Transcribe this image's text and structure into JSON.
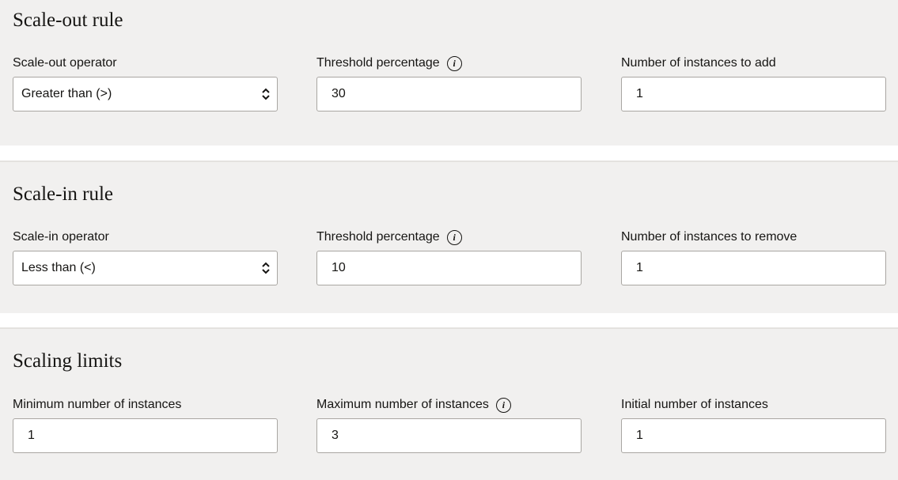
{
  "scale_out": {
    "title": "Scale-out rule",
    "operator_label": "Scale-out operator",
    "operator_value": "Greater than (>)",
    "threshold_label": "Threshold percentage",
    "threshold_value": "30",
    "count_label": "Number of instances to add",
    "count_value": "1"
  },
  "scale_in": {
    "title": "Scale-in rule",
    "operator_label": "Scale-in operator",
    "operator_value": "Less than (<)",
    "threshold_label": "Threshold percentage",
    "threshold_value": "10",
    "count_label": "Number of instances to remove",
    "count_value": "1"
  },
  "limits": {
    "title": "Scaling limits",
    "min_label": "Minimum number of instances",
    "min_value": "1",
    "max_label": "Maximum number of instances",
    "max_value": "3",
    "initial_label": "Initial number of instances",
    "initial_value": "1"
  },
  "icons": {
    "info": "i",
    "info_icon_name": "info-icon",
    "select_icon_name": "up-down-chevron-icon"
  },
  "colors": {
    "panel_background": "#f1f0ef",
    "input_border": "#a9a6a2",
    "text": "#161513"
  }
}
